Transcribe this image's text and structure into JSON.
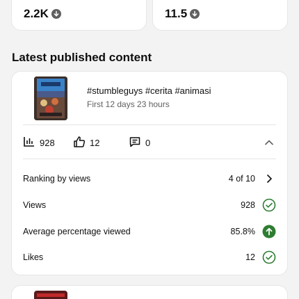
{
  "top_stats": [
    {
      "value": "2.2K",
      "trend_icon": "arrow-down-icon"
    },
    {
      "value": "11.5",
      "trend_icon": "arrow-down-icon"
    }
  ],
  "section_title": "Latest published content",
  "video": {
    "title": "#stumbleguys #cerita #animasi",
    "subtitle": "First 12 days 23 hours",
    "metrics": {
      "views": "928",
      "likes": "12",
      "comments": "0"
    },
    "details": [
      {
        "label": "Ranking by views",
        "value": "4 of 10",
        "icon": "chevron-right-icon"
      },
      {
        "label": "Views",
        "value": "928",
        "icon": "check-circle-icon"
      },
      {
        "label": "Average percentage viewed",
        "value": "85.8%",
        "icon": "arrow-up-circle-icon"
      },
      {
        "label": "Likes",
        "value": "12",
        "icon": "check-circle-icon"
      }
    ]
  },
  "colors": {
    "accent_green": "#2e7d32",
    "text": "#0f0f0f",
    "muted": "#606060",
    "background": "#f3f3f3"
  }
}
